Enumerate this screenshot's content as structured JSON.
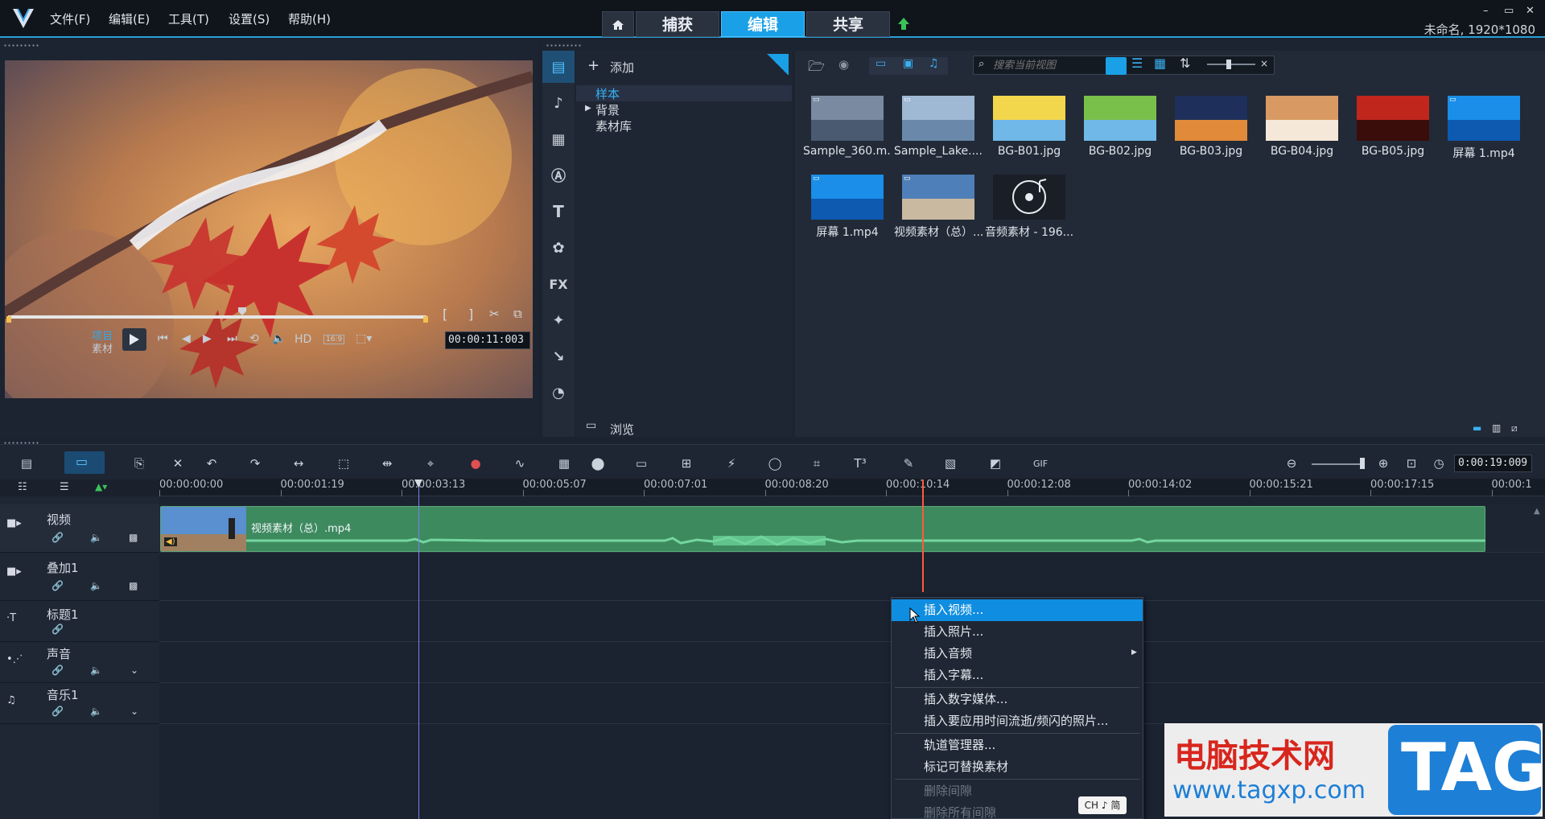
{
  "app": {
    "title_info": "未命名, 1920*1080"
  },
  "menu": [
    "文件(F)",
    "编辑(E)",
    "工具(T)",
    "设置(S)",
    "帮助(H)"
  ],
  "tabs": {
    "home_icon": "home-icon",
    "items": [
      "捕获",
      "编辑",
      "共享"
    ],
    "active": "编辑"
  },
  "window_controls": [
    "–",
    "▭",
    "✕"
  ],
  "preview": {
    "mode_project": "项目",
    "mode_clip": "素材",
    "hd_label": "HD",
    "aspect": "16:9",
    "timecode": "00:00:11:003",
    "scrub_position": 0.56
  },
  "library": {
    "add_label": "添加",
    "tree": {
      "selected": "样本",
      "items": [
        "样本",
        "背景",
        "素材库"
      ]
    },
    "browse_label": "浏览",
    "search_placeholder": "搜索当前视图",
    "thumbnails": [
      {
        "name": "Sample_360.m...",
        "kind": "video"
      },
      {
        "name": "Sample_Lake....",
        "kind": "video"
      },
      {
        "name": "BG-B01.jpg",
        "kind": "image"
      },
      {
        "name": "BG-B02.jpg",
        "kind": "image"
      },
      {
        "name": "BG-B03.jpg",
        "kind": "image"
      },
      {
        "name": "BG-B04.jpg",
        "kind": "image"
      },
      {
        "name": "BG-B05.jpg",
        "kind": "image"
      },
      {
        "name": "屏幕 1.mp4",
        "kind": "video"
      },
      {
        "name": "屏幕 1.mp4",
        "kind": "video"
      },
      {
        "name": "视频素材（总）....",
        "kind": "video"
      },
      {
        "name": "音频素材 - 196...",
        "kind": "audio"
      }
    ]
  },
  "timeline": {
    "duration": "0:00:19:009",
    "ruler": [
      "00:00:00:00",
      "00:00:01:19",
      "00:00:03:13",
      "00:00:05:07",
      "00:00:07:01",
      "00:00:08:20",
      "00:00:10:14",
      "00:00:12:08",
      "00:00:14:02",
      "00:00:15:21",
      "00:00:17:15",
      "00:00:1"
    ],
    "tracks": [
      "视频",
      "叠加1",
      "标题1",
      "声音",
      "音乐1"
    ],
    "clip_name": "视频素材（总）.mp4"
  },
  "context_menu": {
    "items": [
      {
        "label": "插入视频...",
        "state": "selected"
      },
      {
        "label": "插入照片...",
        "state": "normal"
      },
      {
        "label": "插入音频",
        "state": "submenu"
      },
      {
        "label": "插入字幕...",
        "state": "normal"
      },
      {
        "label": "插入数字媒体...",
        "state": "normal"
      },
      {
        "label": "插入要应用时间流逝/频闪的照片...",
        "state": "normal"
      },
      {
        "label": "轨道管理器...",
        "state": "normal"
      },
      {
        "label": "标记可替换素材",
        "state": "normal"
      },
      {
        "label": "删除间隙",
        "state": "disabled"
      },
      {
        "label": "删除所有间隙",
        "state": "disabled"
      }
    ]
  },
  "ime_badge": "CH ♪ 简",
  "watermark": {
    "title": "电脑技术网",
    "url": "www.tagxp.com",
    "tag": "TAG"
  },
  "colors": {
    "accent": "#1aa0e6",
    "clip_green": "#3d8a5f",
    "playhead": "#ff5a3a"
  }
}
